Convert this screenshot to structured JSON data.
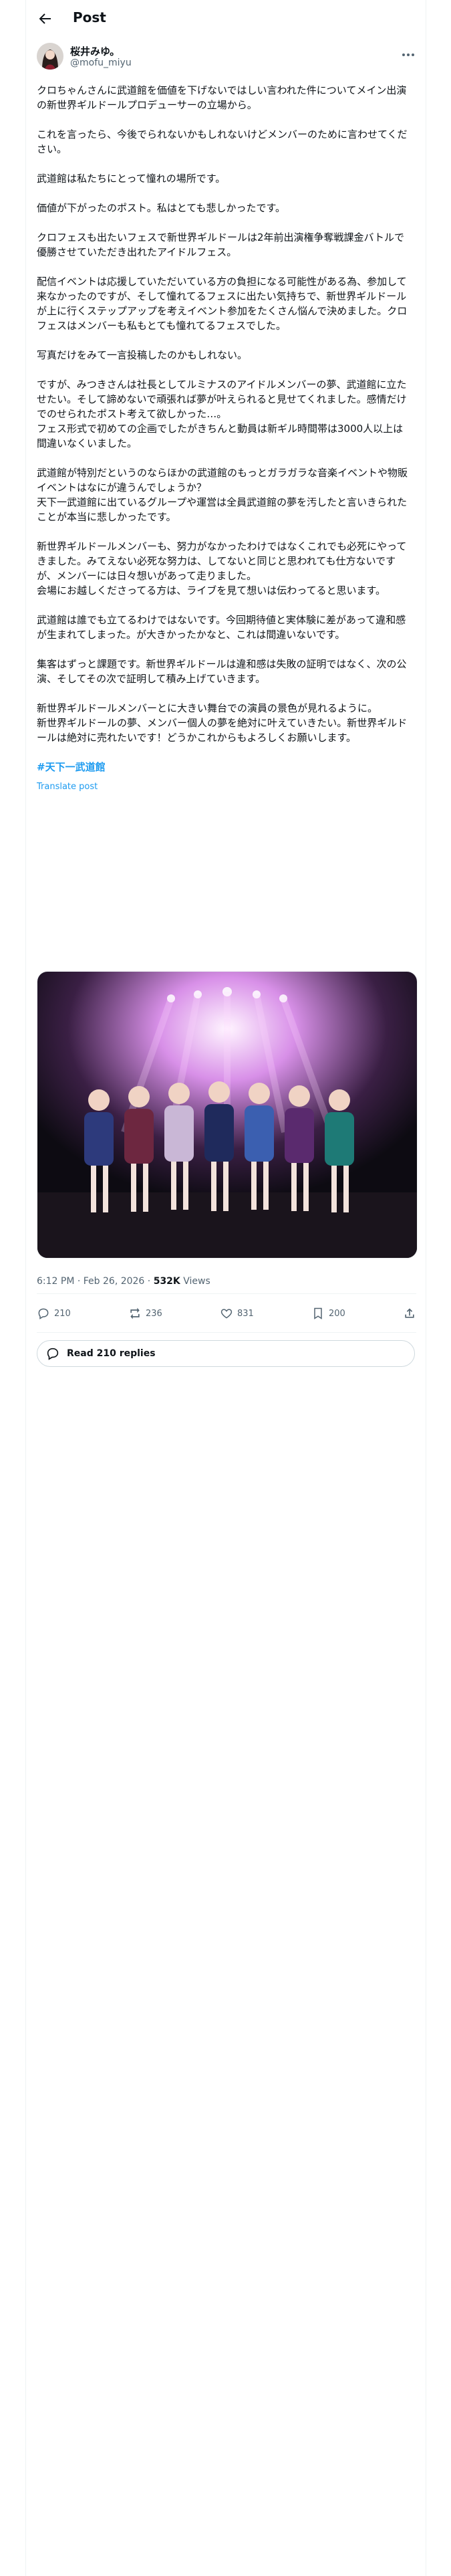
{
  "header": {
    "title": "Post"
  },
  "author": {
    "name": "桜井みゆ。",
    "handle": "@mofu_miyu"
  },
  "post": {
    "paragraphs": [
      "クロちゃんさんに武道館を価値を下げないではしい言われた件についてメイン出演の新世界ギルドールプロデューサーの立場から。",
      "これを言ったら、今後でられないかもしれないけどメンバーのために言わせてください。",
      "武道館は私たちにとって憧れの場所です。",
      "価値が下がったのポスト。私はとても悲しかったです。",
      "クロフェスも出たいフェスで新世界ギルドールは2年前出演権争奪戦課金バトルで優勝させていただき出れたアイドルフェス。",
      "配信イベントは応援していただいている方の負担になる可能性がある為、参加して来なかったのですが、そして憧れてるフェスに出たい気持ちで、新世界ギルドールが上に行くステップアップを考えイベント参加をたくさん悩んで決めました。クロフェスはメンバーも私もとても憧れてるフェスでした。",
      "写真だけをみて一言投稿したのかもしれない。",
      "ですが、みつきさんは社長としてルミナスのアイドルメンバーの夢、武道館に立たせたい。そして諦めないで頑張れば夢が叶えられると見せてくれました。感情だけでのせられたポスト考えて欲しかった…。\nフェス形式で初めての企画でしたがきちんと動員は新ギル時間帯は3000人以上は間違いなくいました。",
      "武道館が特別だというのならほかの武道館のもっとガラガラな音楽イベントや物販イベントはなにが違うんでしょうか？\n天下一武道館に出ているグループや運営は全員武道館の夢を汚したと言いきられたことが本当に悲しかったです。",
      "新世界ギルドールメンバーも、努力がなかったわけではなくこれでも必死にやってきました。みてえない必死な努力は、してないと同じと思われても仕方ないですが、メンバーには日々想いがあって走りました。\n会場にお越しくださってる方は、ライブを見て想いは伝わってると思います。",
      "武道館は誰でも立てるわけではないです。今回期待値と実体験に差があって違和感が生まれてしまった。が大きかったかなと、これは間違いないです。",
      "集客はずっと課題です。新世界ギルドールは違和感は失敗の証明ではなく、次の公演、そしてその次で証明して積み上げていきます。",
      "新世界ギルドールメンバーとに大きい舞台での演員の景色が見れるように。\n新世界ギルドールの夢、メンバー個人の夢を絶対に叶えていきたい。新世界ギルドールは絶対に売れたいです！どうかこれからもよろしくお願いします。"
    ],
    "hashtag": "#天下一武道館",
    "translate": "Translate post",
    "time": "6:12 PM · Feb 26, 2026 · ",
    "views_count": "532K",
    "views_label": " Views"
  },
  "actions": {
    "replies": "210",
    "reposts": "236",
    "likes": "831",
    "bookmarks": "200"
  },
  "read_replies": "Read 210 replies"
}
